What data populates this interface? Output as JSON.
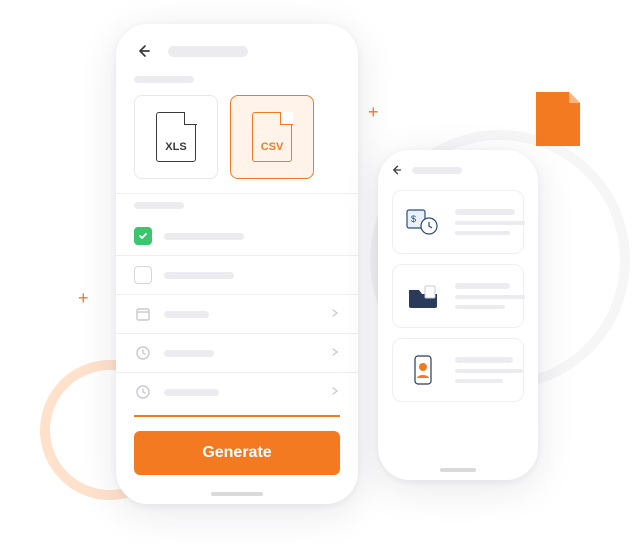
{
  "colors": {
    "accent": "#f47a22",
    "green": "#39c66d"
  },
  "phone1": {
    "back_label": "Back",
    "formats": {
      "xls": {
        "label": "XLS",
        "selected": false
      },
      "csv": {
        "label": "CSV",
        "selected": true
      }
    },
    "generate_label": "Generate"
  },
  "phone2": {
    "back_label": "Back"
  },
  "decor": {
    "file_badge_color": "#f47a22"
  }
}
